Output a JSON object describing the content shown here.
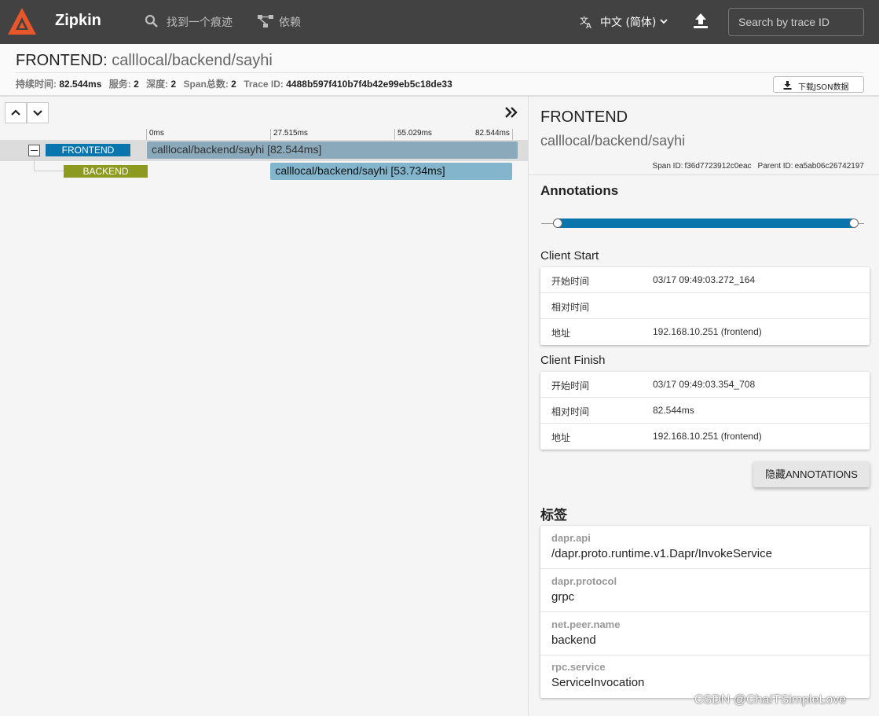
{
  "app": {
    "name": "Zipkin"
  },
  "nav": {
    "find_trace": "找到一个痕迹",
    "dependencies": "依赖",
    "language": "中文 (简体)",
    "search_placeholder": "Search by trace ID"
  },
  "trace": {
    "service": "FRONTEND",
    "name": "calllocal/backend/sayhi",
    "duration_label": "持续时间:",
    "duration": "82.544ms",
    "services_label": "服务:",
    "services": "2",
    "depth_label": "深度:",
    "depth": "2",
    "spans_label": "Span总数:",
    "spans": "2",
    "trace_id_label": "Trace ID:",
    "trace_id": "4488b597f410b7f4b42e99eb5c18de33",
    "download_label": "下载JSON数据"
  },
  "timeline": {
    "ticks": [
      "0ms",
      "27.515ms",
      "55.029ms",
      "82.544ms"
    ],
    "total_ms": 82.544,
    "rows": [
      {
        "service": "FRONTEND",
        "label": "calllocal/backend/sayhi [82.544ms]",
        "start_ms": 0,
        "duration_ms": 82.544,
        "service_color": "#0a75ad",
        "bar_color": "#8aa9ba"
      },
      {
        "service": "BACKEND",
        "label": "calllocal/backend/sayhi [53.734ms]",
        "start_ms": 27.515,
        "duration_ms": 53.734,
        "service_color": "#8d9a20",
        "bar_color": "#83b5cd"
      }
    ]
  },
  "detail": {
    "service": "FRONTEND",
    "name": "calllocal/backend/sayhi",
    "span_id_label": "Span ID:",
    "span_id": "f36d7723912c0eac",
    "parent_id_label": "Parent ID:",
    "parent_id": "ea5ab06c26742197",
    "annotations_heading": "Annotations",
    "annotations": [
      {
        "title": "Client Start",
        "rows": [
          {
            "key": "开始时间",
            "value": "03/17 09:49:03.272_164"
          },
          {
            "key": "相对时间",
            "value": ""
          },
          {
            "key": "地址",
            "value": "192.168.10.251 (frontend)"
          }
        ]
      },
      {
        "title": "Client Finish",
        "rows": [
          {
            "key": "开始时间",
            "value": "03/17 09:49:03.354_708"
          },
          {
            "key": "相对时间",
            "value": "82.544ms"
          },
          {
            "key": "地址",
            "value": "192.168.10.251 (frontend)"
          }
        ]
      }
    ],
    "hide_button": "隐藏ANNOTATIONS",
    "tags_heading": "标签",
    "tags": [
      {
        "key": "dapr.api",
        "value": "/dapr.proto.runtime.v1.Dapr/InvokeService"
      },
      {
        "key": "dapr.protocol",
        "value": "grpc"
      },
      {
        "key": "net.peer.name",
        "value": "backend"
      },
      {
        "key": "rpc.service",
        "value": "ServiceInvocation"
      }
    ]
  },
  "watermark": "CSDN @ChaITSimpleLove"
}
